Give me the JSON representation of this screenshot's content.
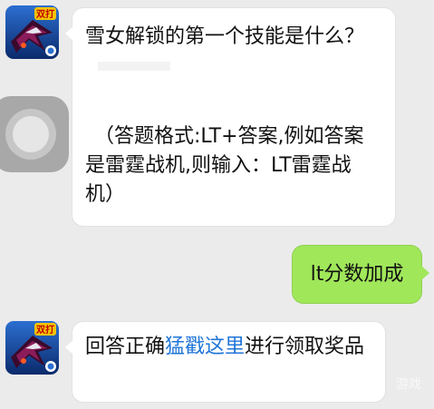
{
  "messages": [
    {
      "sender": "bot",
      "question": "雪女解锁的第一个技能是什么？",
      "hint": "（答题格式:LT+答案,例如答案是雷霆战机,则输入：LT雷霆战机）"
    },
    {
      "sender": "user",
      "text": "lt分数加成"
    },
    {
      "sender": "bot",
      "prefix": "回答正确",
      "link": "猛戳这里",
      "suffix": "进行领取奖品"
    }
  ],
  "avatar_badge": "双打",
  "watermark": "游戏",
  "colors": {
    "background": "#ebebeb",
    "outgoing_bubble": "#a0e75a",
    "link": "#1f75d8"
  },
  "icons": [
    "game-avatar-icon",
    "assistive-touch-icon"
  ]
}
